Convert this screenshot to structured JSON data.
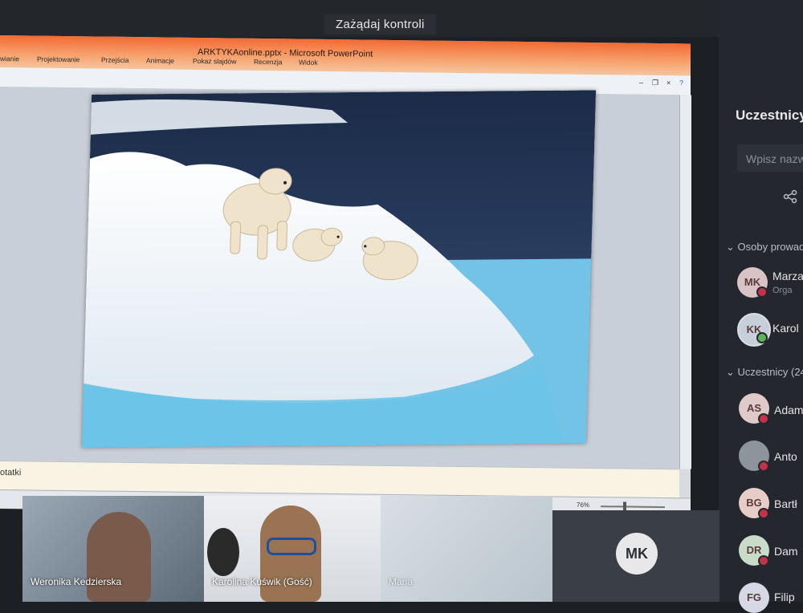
{
  "top": {
    "request_control": "Zażądaj kontroli"
  },
  "ppt": {
    "title": "ARKTYKAonline.pptx - Microsoft PowerPoint",
    "menu": [
      "wianie",
      "Projektowanie",
      "Przejścia",
      "Animacje",
      "Pokaz slajdów",
      "Recenzja",
      "Widok"
    ],
    "notes_label": "otatki",
    "zoom": "76%"
  },
  "panel": {
    "title": "Uczestnicy",
    "search_placeholder": "Wpisz nazw",
    "section_presenters": "Osoby prowad",
    "section_attendees": "Uczestnicy (24",
    "presenters": [
      {
        "initials": "MK",
        "name": "Marza",
        "sub": "Orga",
        "color": "#d9c3c7"
      },
      {
        "initials": "KK",
        "name": "Karol",
        "color": "#c7cfda"
      }
    ],
    "attendees": [
      {
        "initials": "AS",
        "name": "Adam",
        "color": "#e0c9c9"
      },
      {
        "initials": "",
        "name": "Anto",
        "color": "#8d949c"
      },
      {
        "initials": "BG",
        "name": "Bartł",
        "color": "#e6cdc8"
      },
      {
        "initials": "DR",
        "name": "Dam",
        "color": "#c9dcc9"
      },
      {
        "initials": "FG",
        "name": "Filip",
        "color": "#d6d8e6"
      }
    ]
  },
  "video": {
    "tiles": [
      {
        "name": "Weronika Kedzierska"
      },
      {
        "name": "Karolina Kuświk (Gość)"
      },
      {
        "name": "Maria"
      }
    ],
    "mk_initials": "MK"
  }
}
